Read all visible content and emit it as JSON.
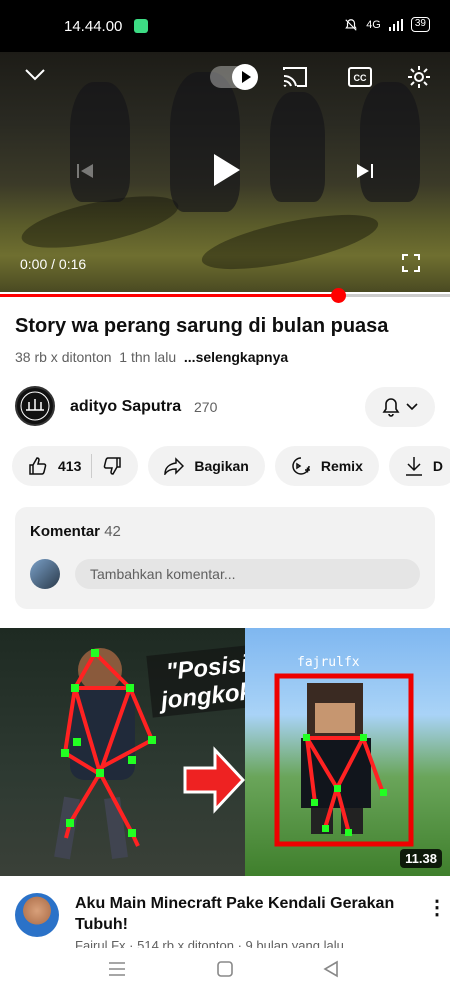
{
  "status_bar": {
    "time": "14.44.00",
    "network": "4G",
    "battery": "39"
  },
  "player": {
    "current_time": "0:00",
    "duration": "0:16",
    "time_separator": " / ",
    "progress_fraction": 0.75
  },
  "video": {
    "title": "Story wa perang sarung di bulan puasa",
    "views": "38 rb x ditonton",
    "age": "1 thn lalu",
    "more_label": "...selengkapnya"
  },
  "channel": {
    "name": "adityo Saputra",
    "subscribers": "270"
  },
  "actions": {
    "likes": "413",
    "share_label": "Bagikan",
    "remix_label": "Remix",
    "download_label": "D"
  },
  "comments": {
    "title": "Komentar",
    "count": "42",
    "placeholder": "Tambahkan komentar..."
  },
  "next_video": {
    "thumbnail_text_1": "\"Posisi",
    "thumbnail_text_2": "jongkok\"",
    "thumbnail_tag": "fajrulfx",
    "duration": "11.38",
    "title": "Aku Main Minecraft Pake Kendali Gerakan Tubuh!",
    "meta": "Fajrul Fx · 514 rb x ditonton · 9 bulan yang lalu"
  }
}
